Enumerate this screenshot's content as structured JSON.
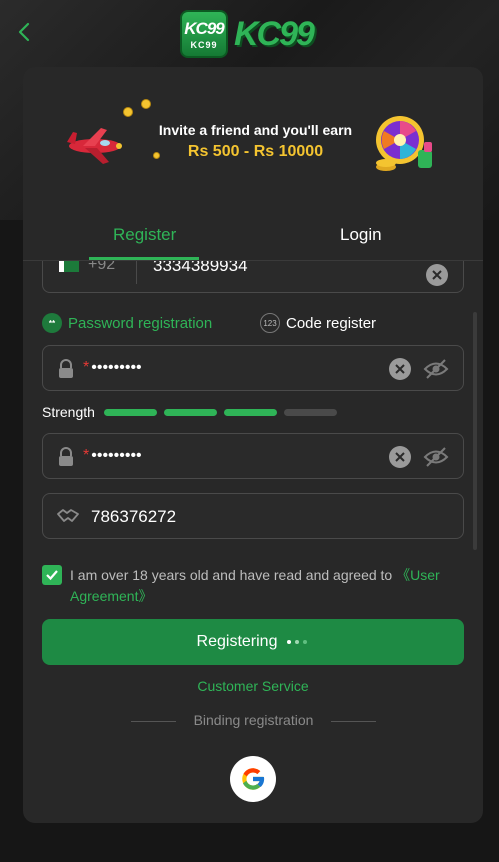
{
  "header": {
    "logo_badge_text": "KC99",
    "logo_badge_sub": "KC99",
    "logo_word": "KC99",
    "back_icon": "chevron-left-icon"
  },
  "banner": {
    "line1": "Invite a friend and you'll earn",
    "line2": "Rs 500 - Rs 10000"
  },
  "tabs": [
    {
      "label": "Register",
      "active": true
    },
    {
      "label": "Login",
      "active": false
    }
  ],
  "phone": {
    "country_code": "+92",
    "value": "3334389934"
  },
  "registration_options": {
    "password": {
      "label": "Password registration",
      "icon_text": "**"
    },
    "code": {
      "label": "Code register",
      "icon_text": "123"
    }
  },
  "password": {
    "required_mark": "*",
    "value": "•••••••••"
  },
  "strength": {
    "label": "Strength",
    "level": 3,
    "total": 4,
    "active_color": "#2fb457",
    "inactive_color": "#4a4a4a"
  },
  "confirm_password": {
    "required_mark": "*",
    "value": "•••••••••"
  },
  "invite_code": {
    "value": "786376272"
  },
  "agreement": {
    "checked": true,
    "text": "I am over 18 years old and have read and agreed to ",
    "link": "《User Agreement》"
  },
  "submit": {
    "label": "Registering"
  },
  "customer_service": "Customer Service",
  "binding_label": "Binding registration",
  "colors": {
    "accent": "#2fb457",
    "button": "#1e8a44",
    "card": "#282828",
    "background": "#161616"
  }
}
